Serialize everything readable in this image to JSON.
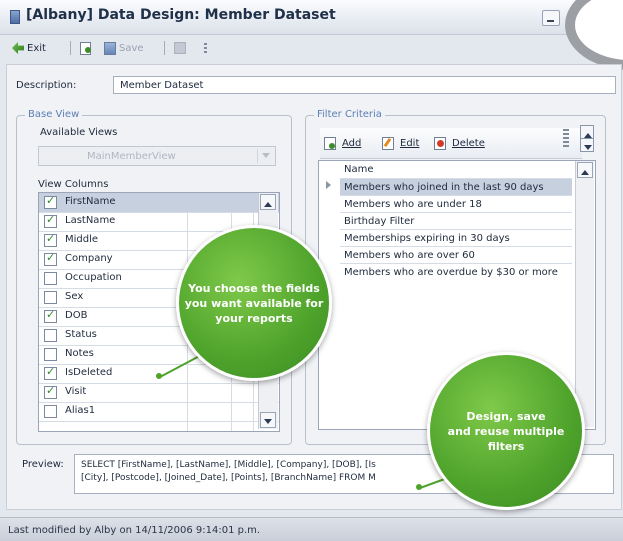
{
  "window": {
    "title": "[Albany] Data Design: Member Dataset"
  },
  "toolbar": {
    "exit": "Exit",
    "save": "Save"
  },
  "description": {
    "label": "Description:",
    "value": "Member Dataset"
  },
  "base_view": {
    "title": "Base View",
    "available_label": "Available Views",
    "available_value": "MainMemberView",
    "columns_label": "View Columns",
    "columns": [
      {
        "name": "FirstName",
        "checked": true
      },
      {
        "name": "LastName",
        "checked": true
      },
      {
        "name": "Middle",
        "checked": true
      },
      {
        "name": "Company",
        "checked": true
      },
      {
        "name": "Occupation",
        "checked": false
      },
      {
        "name": "Sex",
        "checked": false
      },
      {
        "name": "DOB",
        "checked": true
      },
      {
        "name": "Status",
        "checked": false
      },
      {
        "name": "Notes",
        "checked": false
      },
      {
        "name": "IsDeleted",
        "checked": true
      },
      {
        "name": "Visit",
        "checked": true
      },
      {
        "name": "Alias1",
        "checked": false
      }
    ]
  },
  "filter": {
    "title": "Filter Criteria",
    "add": "Add",
    "edit": "Edit",
    "delete": "Delete",
    "column_header": "Name",
    "rows": [
      "Members who joined in the last 90 days",
      "Members who are under 18",
      "Birthday Filter",
      "Memberships expiring in 30 days",
      "Members who are over 60",
      "Members who are overdue by $30 or more"
    ]
  },
  "preview": {
    "label": "Preview:",
    "line1": "SELECT [FirstName], [LastName], [Middle], [Company], [DOB], [Is",
    "line2": "[City], [Postcode], [Joined_Date], [Points], [BranchName] FROM M"
  },
  "status": {
    "text": "Last modified by  Alby on 14/11/2006 9:14:01 p.m."
  },
  "callouts": {
    "left": [
      "You choose the fields",
      "you want available for",
      "your reports"
    ],
    "right": [
      "Design, save",
      "and reuse multiple",
      "filters"
    ]
  }
}
